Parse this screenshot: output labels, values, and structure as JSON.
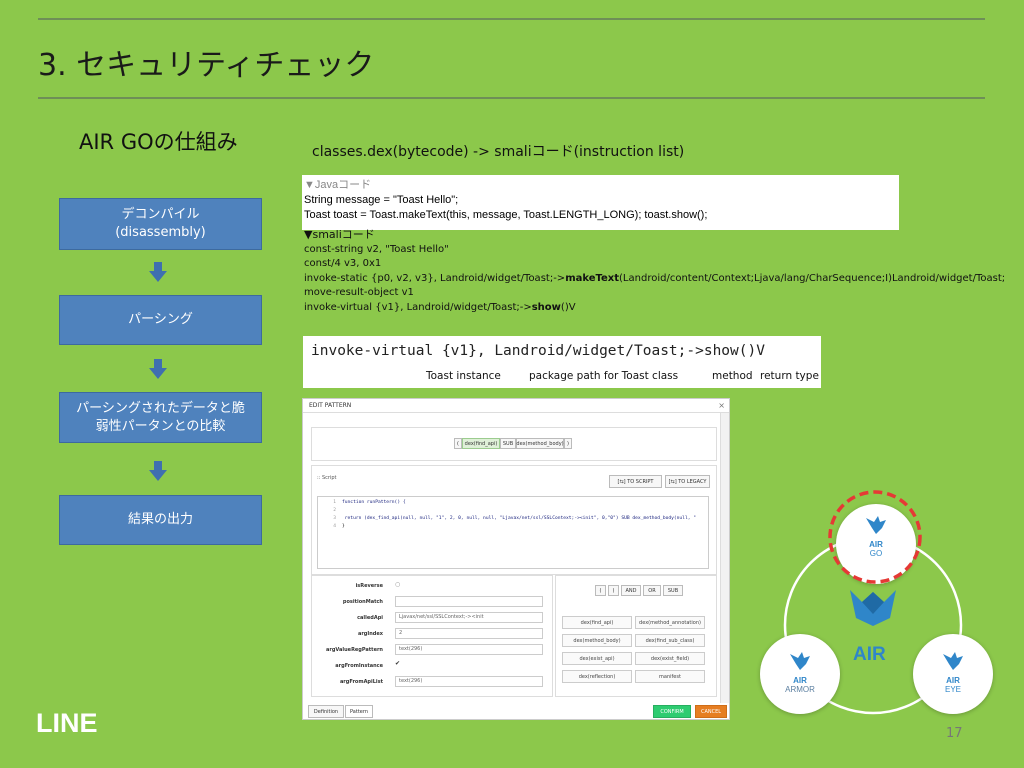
{
  "slide": {
    "title": "3. セキュリティチェック",
    "subtitle": "AIR GOの仕組み",
    "page_number": "17",
    "logo": "LINE"
  },
  "flow": {
    "steps": [
      {
        "label": "デコンパイル\n(disassembly)"
      },
      {
        "label": "パーシング"
      },
      {
        "label": "パーシングされたデータと脆\n弱性パータンとの比較"
      },
      {
        "label": "結果の出力"
      }
    ],
    "arrow_icon": "down-arrow-icon"
  },
  "classes_text": "classes.dex(bytecode) -> smaliコード(instruction list)",
  "java": {
    "header": "▼Javaコード",
    "lines": [
      "String message = \"Toast Hello\";",
      "Toast toast = Toast.makeText(this,  message,  Toast.LENGTH_LONG);   toast.show();"
    ]
  },
  "smali": {
    "header": "▼smaliコード",
    "line1": "const-string v2, \"Toast Hello\"",
    "line2": "const/4 v3, 0x1",
    "line3_pre": "invoke-static {p0, v2, v3}, Landroid/widget/Toast;->",
    "line3_bold": "makeText",
    "line3_post": "(Landroid/content/Context;Ljava/lang/CharSequence;I)Landroid/widget/Toast;",
    "line4": "move-result-object v1",
    "line5_pre": "invoke-virtual {v1}, Landroid/widget/Toast;->",
    "line5_bold": "show",
    "line5_post": "()V"
  },
  "invoke": {
    "code": "invoke-virtual {v1}, Landroid/widget/Toast;->show()V",
    "label_instance": "Toast instance",
    "label_package": "package path for Toast class",
    "label_method": "method",
    "label_return": "return type"
  },
  "edit_pattern": {
    "title": "EDIT PATTERN",
    "close": "×",
    "tokens": [
      "(",
      "dex(find_api)",
      "SUB",
      "dex(method_body)",
      ")"
    ],
    "script_label": ":: Script",
    "to_script": "[⇆] TO SCRIPT",
    "to_legacy": "[⇆] TO LEGACY",
    "code_lines": [
      {
        "n": "1",
        "text": "function runPattern() {"
      },
      {
        "n": "2",
        "text": ""
      },
      {
        "n": "3",
        "text": "    return (dex_find_api(null, null, \"1\", 2, 0, null, null, \"Ljavax/net/ssl/SSLContext;-><init\", 0,\"0\") SUB dex_method_body(null, \""
      },
      {
        "n": "4",
        "text": "}"
      }
    ],
    "fields": [
      {
        "label": "isReverse",
        "value": "○"
      },
      {
        "label": "positionMatch",
        "value": ""
      },
      {
        "label": "calledApi",
        "value": "Ljavax/net/ssl/SSLContext;-><init"
      },
      {
        "label": "argIndex",
        "value": "2"
      },
      {
        "label": "argValueRegPattern",
        "value": "text(296)"
      },
      {
        "label": "argFromInstance",
        "value": "✔"
      },
      {
        "label": "argFromApiList",
        "value": "text(296)"
      }
    ],
    "ops": [
      "(",
      ")",
      "AND",
      "OR",
      "SUB"
    ],
    "grid_buttons": [
      [
        "dex(find_api)",
        "dex(method_annotation)"
      ],
      [
        "dex(method_body)",
        "dex(find_sub_class)"
      ],
      [
        "dex(exist_api)",
        "dex(exist_field)"
      ],
      [
        "dex(reflection)",
        "manifest"
      ]
    ],
    "tab_definition": "Definition",
    "tab_pattern": "Pattern",
    "confirm": "CONFIRM",
    "cancel": "CANCEL"
  },
  "air_diagram": {
    "center_label": "AIR",
    "go_top": "AIR",
    "go_bottom": "GO",
    "armor_top": "AIR",
    "armor_bottom": "ARMOR",
    "eye_top": "AIR",
    "eye_bottom": "EYE",
    "highlight_color": "#e53935",
    "brand_blue": "#2f86c9"
  },
  "colors": {
    "background": "#8cc84b",
    "flow_box": "#4f82bd",
    "confirm": "#2ecc71",
    "cancel": "#e67e22"
  }
}
